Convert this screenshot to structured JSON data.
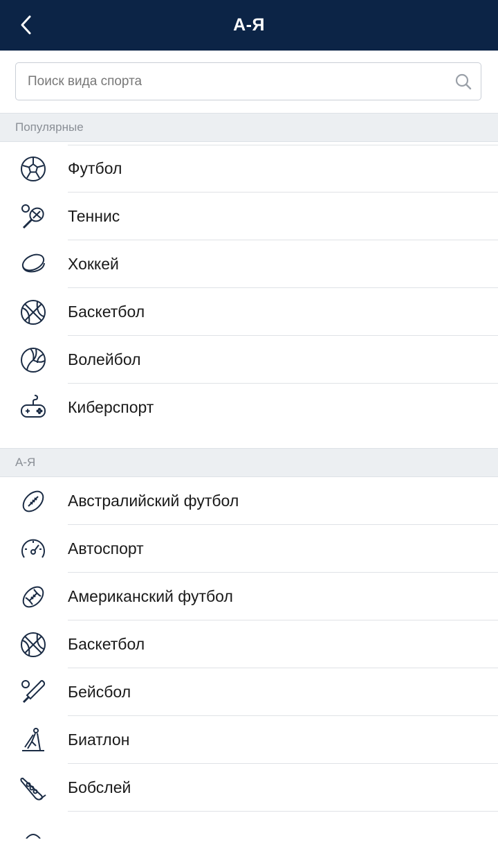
{
  "header": {
    "title": "А-Я",
    "back_icon": "chevron-left-icon"
  },
  "search": {
    "placeholder": "Поиск вида спорта",
    "value": "",
    "icon": "search-icon"
  },
  "sections": [
    {
      "title": "Популярные",
      "items": [
        {
          "label": "Футбол",
          "icon": "soccer-ball-icon"
        },
        {
          "label": "Теннис",
          "icon": "tennis-racket-icon"
        },
        {
          "label": "Хоккей",
          "icon": "hockey-puck-icon"
        },
        {
          "label": "Баскетбол",
          "icon": "basketball-icon"
        },
        {
          "label": "Волейбол",
          "icon": "volleyball-icon"
        },
        {
          "label": "Киберспорт",
          "icon": "gamepad-icon"
        }
      ]
    },
    {
      "title": "А-Я",
      "items": [
        {
          "label": "Австралийский футбол",
          "icon": "aussie-rules-ball-icon"
        },
        {
          "label": "Автоспорт",
          "icon": "speedometer-icon"
        },
        {
          "label": "Американский футбол",
          "icon": "american-football-icon"
        },
        {
          "label": "Баскетбол",
          "icon": "basketball-icon"
        },
        {
          "label": "Бейсбол",
          "icon": "baseball-bat-icon"
        },
        {
          "label": "Биатлон",
          "icon": "biathlon-icon"
        },
        {
          "label": "Бобслей",
          "icon": "bobsleigh-icon"
        }
      ]
    }
  ],
  "colors": {
    "header_bg": "#0c2446",
    "section_bg": "#eceff2",
    "text": "#1a1a1a",
    "muted": "#8a8f96"
  }
}
